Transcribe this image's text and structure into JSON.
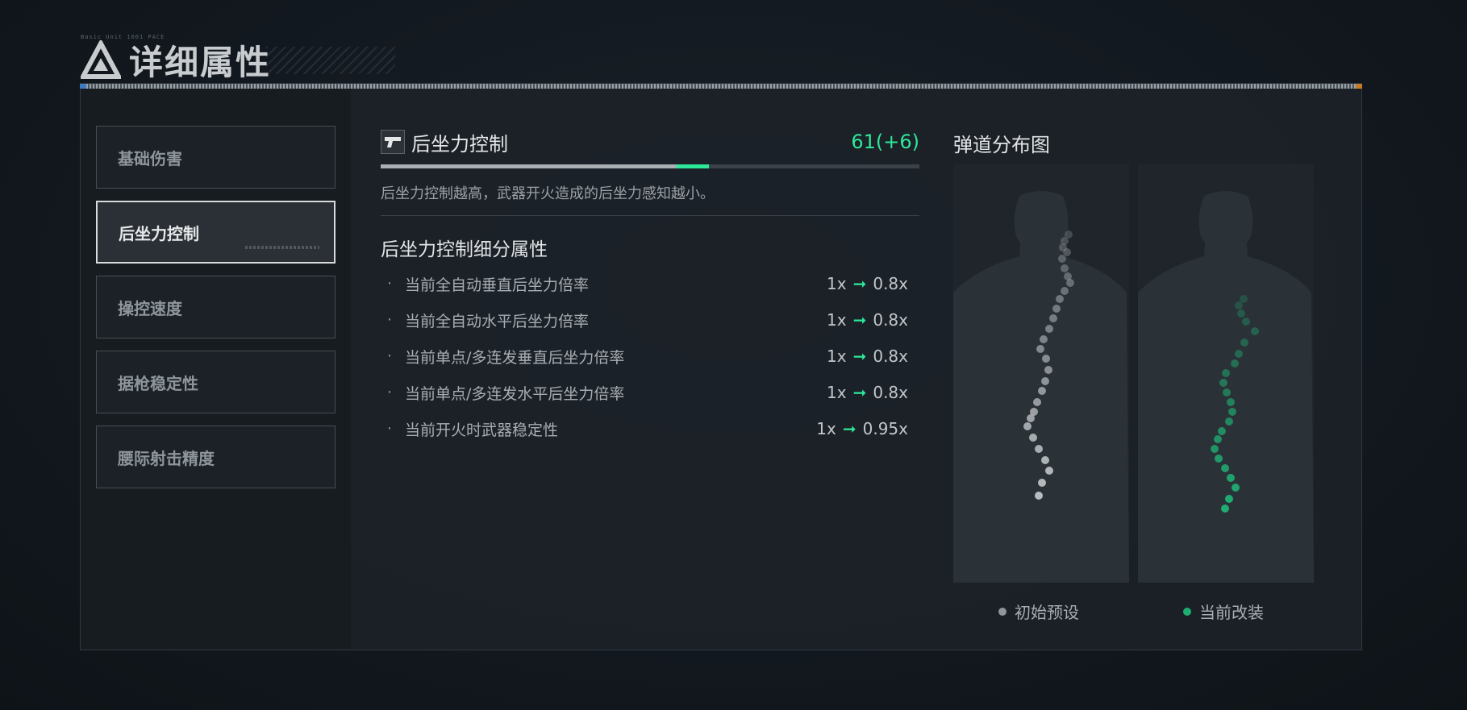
{
  "header": {
    "title": "详细属性",
    "tag": "Basic Unit 1001 PACE"
  },
  "sidebar": {
    "items": [
      {
        "label": "基础伤害",
        "active": false
      },
      {
        "label": "后坐力控制",
        "active": true
      },
      {
        "label": "操控速度",
        "active": false
      },
      {
        "label": "据枪稳定性",
        "active": false
      },
      {
        "label": "腰际射击精度",
        "active": false
      }
    ]
  },
  "main": {
    "stat_title": "后坐力控制",
    "stat_value": "61(+6)",
    "progress": {
      "base_fraction": 0.55,
      "bonus_fraction": 0.06
    },
    "description": "后坐力控制越高，武器开火造成的后坐力感知越小。",
    "sub_title": "后坐力控制细分属性",
    "attributes": [
      {
        "bullet": "·",
        "name": "当前全自动垂直后坐力倍率",
        "from": "1x",
        "to": "0.8x"
      },
      {
        "bullet": "·",
        "name": "当前全自动水平后坐力倍率",
        "from": "1x",
        "to": "0.8x"
      },
      {
        "bullet": "·",
        "name": "当前单点/多连发垂直后坐力倍率",
        "from": "1x",
        "to": "0.8x"
      },
      {
        "bullet": "·",
        "name": "当前单点/多连发水平后坐力倍率",
        "from": "1x",
        "to": "0.8x"
      },
      {
        "bullet": "·",
        "name": "当前开火时武器稳定性",
        "from": "1x",
        "to": "0.95x"
      }
    ],
    "arrow_glyph": "➞"
  },
  "chart": {
    "title": "弹道分布图",
    "legend": [
      {
        "label": "初始预设",
        "color": "#8f9599"
      },
      {
        "label": "当前改装",
        "color": "#1fae72"
      }
    ]
  },
  "colors": {
    "accent": "#2ee89a",
    "initial_dots": "#b9bdc0",
    "modified_dots": "#1fae72"
  }
}
